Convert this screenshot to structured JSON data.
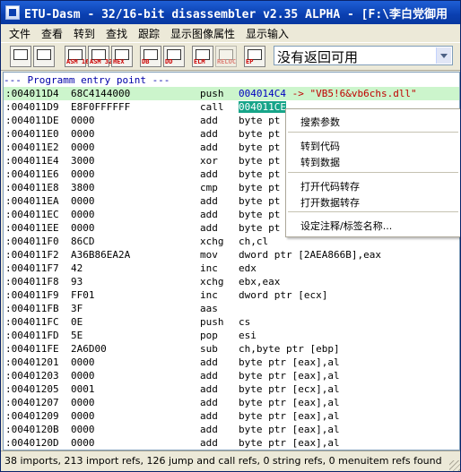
{
  "window": {
    "title": "ETU-Dasm - 32/16-bit disassembler v2.35 ALPHA - [F:\\李白党御用"
  },
  "menu": {
    "items": [
      "文件",
      "查看",
      "转到",
      "查找",
      "跟踪",
      "显示图像属性",
      "显示输入"
    ]
  },
  "toolbar": {
    "buttons": [
      {
        "icon": "goto-address-icon",
        "mini": ""
      },
      {
        "icon": "goto-back-icon",
        "mini": ""
      },
      {
        "icon": "asm16-icon",
        "mini": "ASM 16"
      },
      {
        "icon": "asm32-icon",
        "mini": "ASM 32"
      },
      {
        "icon": "hex-icon",
        "mini": "HEX"
      },
      {
        "icon": "db-icon",
        "mini": "DB"
      },
      {
        "icon": "dd-icon",
        "mini": "DD"
      },
      {
        "icon": "elm-icon",
        "mini": "ELM"
      },
      {
        "icon": "reloc-icon",
        "mini": "RELOC"
      },
      {
        "icon": "ep-icon",
        "mini": "EP"
      }
    ],
    "combo_value": "没有返回可用"
  },
  "listing": {
    "entry_label": "--- Programm entry point ---",
    "rows": [
      {
        "addr": ":004011D4",
        "bytes": "68C4144000",
        "mnem": "push",
        "op_pre": "",
        "op_sel": "",
        "op_blue": "004014C4",
        "op_red": " -> \"VB5!6&vb6chs.dll\"",
        "op_rest": "",
        "hl": true
      },
      {
        "addr": ":004011D9",
        "bytes": "E8F0FFFFFF",
        "mnem": "call",
        "op_pre": "",
        "op_sel": "004011CE",
        "op_blue": "",
        "op_red": "",
        "op_rest": "",
        "hl": false
      },
      {
        "addr": ":004011DE",
        "bytes": "0000",
        "mnem": "add",
        "op_pre": "byte pt",
        "hl": false
      },
      {
        "addr": ":004011E0",
        "bytes": "0000",
        "mnem": "add",
        "op_pre": "byte pt",
        "hl": false
      },
      {
        "addr": ":004011E2",
        "bytes": "0000",
        "mnem": "add",
        "op_pre": "byte pt",
        "hl": false
      },
      {
        "addr": ":004011E4",
        "bytes": "3000",
        "mnem": "xor",
        "op_pre": "byte pt",
        "hl": false
      },
      {
        "addr": ":004011E6",
        "bytes": "0000",
        "mnem": "add",
        "op_pre": "byte pt",
        "hl": false
      },
      {
        "addr": ":004011E8",
        "bytes": "3800",
        "mnem": "cmp",
        "op_pre": "byte pt",
        "hl": false
      },
      {
        "addr": ":004011EA",
        "bytes": "0000",
        "mnem": "add",
        "op_pre": "byte pt",
        "hl": false
      },
      {
        "addr": ":004011EC",
        "bytes": "0000",
        "mnem": "add",
        "op_pre": "byte pt",
        "hl": false
      },
      {
        "addr": ":004011EE",
        "bytes": "0000",
        "mnem": "add",
        "op_pre": "byte pt",
        "hl": false
      },
      {
        "addr": ":004011F0",
        "bytes": "86CD",
        "mnem": "xchg",
        "op_pre": "ch,cl",
        "hl": false
      },
      {
        "addr": ":004011F2",
        "bytes": "A36B86EA2A",
        "mnem": "mov",
        "op_pre": "dword ptr [2AEA866B],eax",
        "hl": false
      },
      {
        "addr": ":004011F7",
        "bytes": "42",
        "mnem": "inc",
        "op_pre": "edx",
        "hl": false
      },
      {
        "addr": ":004011F8",
        "bytes": "93",
        "mnem": "xchg",
        "op_pre": "ebx,eax",
        "hl": false
      },
      {
        "addr": ":004011F9",
        "bytes": "FF01",
        "mnem": "inc",
        "op_pre": "dword ptr [ecx]",
        "hl": false
      },
      {
        "addr": ":004011FB",
        "bytes": "3F",
        "mnem": "aas",
        "op_pre": "",
        "hl": false
      },
      {
        "addr": ":004011FC",
        "bytes": "0E",
        "mnem": "push",
        "op_pre": "cs",
        "hl": false
      },
      {
        "addr": ":004011FD",
        "bytes": "5E",
        "mnem": "pop",
        "op_pre": "esi",
        "hl": false
      },
      {
        "addr": ":004011FE",
        "bytes": "2A6D00",
        "mnem": "sub",
        "op_pre": "ch,byte ptr [ebp]",
        "hl": false
      },
      {
        "addr": ":00401201",
        "bytes": "0000",
        "mnem": "add",
        "op_pre": "byte ptr [eax],al",
        "hl": false
      },
      {
        "addr": ":00401203",
        "bytes": "0000",
        "mnem": "add",
        "op_pre": "byte ptr [eax],al",
        "hl": false
      },
      {
        "addr": ":00401205",
        "bytes": "0001",
        "mnem": "add",
        "op_pre": "byte ptr [ecx],al",
        "hl": false
      },
      {
        "addr": ":00401207",
        "bytes": "0000",
        "mnem": "add",
        "op_pre": "byte ptr [eax],al",
        "hl": false
      },
      {
        "addr": ":00401209",
        "bytes": "0000",
        "mnem": "add",
        "op_pre": "byte ptr [eax],al",
        "hl": false
      },
      {
        "addr": ":0040120B",
        "bytes": "0000",
        "mnem": "add",
        "op_pre": "byte ptr [eax],al",
        "hl": false
      },
      {
        "addr": ":0040120D",
        "bytes": "0000",
        "mnem": "add",
        "op_pre": "byte ptr [eax],al",
        "hl": false
      }
    ]
  },
  "context_menu": {
    "items": [
      "搜索参数",
      "转到代码",
      "转到数据",
      "打开代码转存",
      "打开数据转存",
      "设定注释/标签名称..."
    ]
  },
  "status": {
    "text": "38 imports, 213 import refs, 126 jump and call refs, 0 string refs, 0 menuitem refs found"
  },
  "colors": {
    "title_bar": "#0a3fb0",
    "highlight_row": "#ccf5cc",
    "selected_operand": "#17a589",
    "entry_label": "#0000a8",
    "address_ref": "#0000c0",
    "string_ref": "#c00000"
  }
}
